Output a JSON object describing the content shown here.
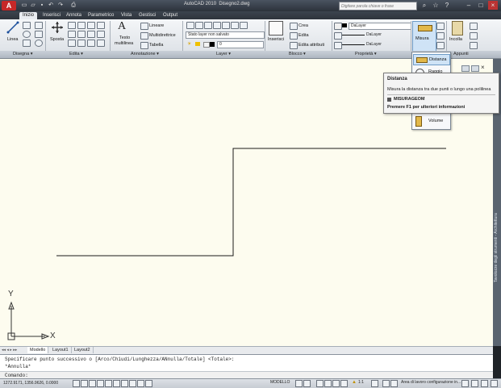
{
  "app": {
    "window_title": "AutoCAD 2010",
    "document": "Disegno2.dwg",
    "search_placeholder": "Digitare parola chiave o frase"
  },
  "tabs": [
    "Inizio",
    "Inserisci",
    "Annota",
    "Parametrico",
    "Vista",
    "Gestisci",
    "Output"
  ],
  "active_tab": "Inizio",
  "ribbon": {
    "disegna": {
      "line_label": "Linea"
    },
    "edita": {
      "move_label": "Sposta"
    },
    "annotazione": {
      "text_label_1": "Testo",
      "text_label_2": "multilinea",
      "lineare": "Lineare",
      "multidirettrice": "Multidirettrice",
      "tabella": "Tabella"
    },
    "layer": {
      "state_combo": "Stato layer non salvato",
      "layer_combo": "0"
    },
    "blocco": {
      "insert_label": "Inserisci",
      "crea": "Crea",
      "edita": "Edita",
      "edita_attributi": "Edita attributi"
    },
    "proprieta": {
      "color_combo": "DaLayer",
      "linetype_combo": "DaLayer",
      "lineweight_combo": "DaLayer"
    },
    "utilita": {
      "misura_label": "Misura"
    },
    "appunti": {
      "incolla_label": "Incolla"
    }
  },
  "panel_labels": {
    "disegna": "Disegna",
    "edita": "Edita",
    "annotazione": "Annotazione",
    "layer": "Layer",
    "blocco": "Blocco",
    "proprieta": "Proprietà",
    "appunti": "Appunti"
  },
  "dropdown": {
    "items": [
      "Distanza",
      "Raggio",
      "Volume"
    ]
  },
  "tooltip": {
    "title": "Distanza",
    "description": "Misura la distanza tra due punti o lungo una polilinea",
    "command": "MISURAGEOM",
    "help": "Premere F1 per ulteriori informazioni"
  },
  "palette_label": "Tavolozze degli strumenti - Architettura",
  "ucs": {
    "x": "X",
    "y": "Y"
  },
  "layout_tabs": [
    "Modello",
    "Layout1",
    "Layout2"
  ],
  "active_layout": "Modello",
  "command": {
    "history_1": "Specificare punto successivo o [Arco/Chiudi/Lunghezza/ANnulla/Totale] <Totale>:",
    "history_2": "*Annulla*",
    "prompt": "Comando:"
  },
  "status": {
    "coords": "1272.9171, 1356.9626, 0.0000",
    "space": "MODELLO",
    "scale": "1:1",
    "workspace": "Area di lavoro configurazione in..."
  },
  "colors": {
    "drawing_bg": "#fdfcef",
    "line": "#1a1a1a",
    "accent": "#c62828"
  }
}
